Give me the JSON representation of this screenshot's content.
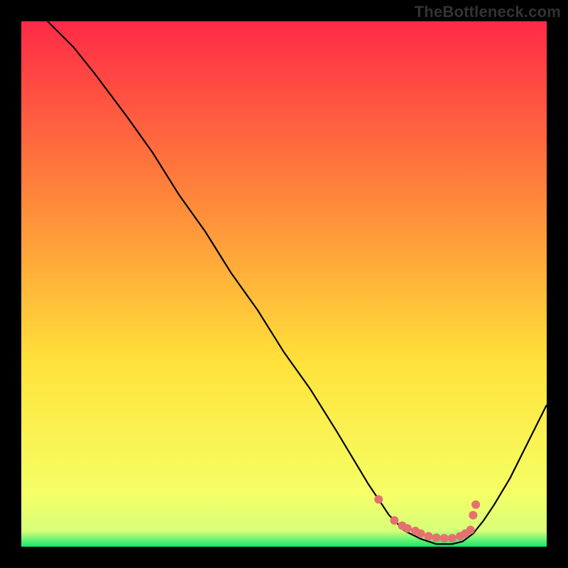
{
  "watermark": "TheBottleneck.com",
  "chart_data": {
    "type": "line",
    "title": "",
    "xlabel": "",
    "ylabel": "",
    "xlim": [
      0,
      100
    ],
    "ylim": [
      0,
      100
    ],
    "grid": false,
    "legend": false,
    "background_gradient": {
      "stops": [
        {
          "offset": 0.0,
          "color": "#ff2a47"
        },
        {
          "offset": 0.35,
          "color": "#ff8a3a"
        },
        {
          "offset": 0.65,
          "color": "#ffe23a"
        },
        {
          "offset": 0.9,
          "color": "#f5ff66"
        },
        {
          "offset": 0.97,
          "color": "#d7ff7a"
        },
        {
          "offset": 1.0,
          "color": "#12e86e"
        }
      ]
    },
    "series": [
      {
        "name": "bottleneck-curve",
        "color": "#000000",
        "x": [
          5,
          10,
          14,
          17,
          20,
          25,
          30,
          35,
          40,
          45,
          50,
          55,
          60,
          63,
          66,
          68,
          70,
          73,
          76,
          79,
          82,
          84,
          86,
          88,
          90,
          93,
          96,
          100
        ],
        "y": [
          100,
          95,
          90,
          86,
          82,
          75,
          67,
          60,
          52,
          45,
          37,
          30,
          22,
          17,
          12,
          9,
          6,
          3,
          1.5,
          0.5,
          0.5,
          1,
          2.5,
          5,
          8,
          13,
          19,
          27
        ]
      }
    ],
    "highlight_points": {
      "name": "sweet-spot",
      "color": "#e4716f",
      "radius": 6,
      "points": [
        {
          "x": 68,
          "y": 9
        },
        {
          "x": 71,
          "y": 5
        },
        {
          "x": 72.5,
          "y": 4
        },
        {
          "x": 73.5,
          "y": 3.5
        },
        {
          "x": 75,
          "y": 3
        },
        {
          "x": 76,
          "y": 2.5
        },
        {
          "x": 77.5,
          "y": 2
        },
        {
          "x": 79,
          "y": 1.7
        },
        {
          "x": 80.5,
          "y": 1.6
        },
        {
          "x": 82,
          "y": 1.6
        },
        {
          "x": 83.5,
          "y": 2
        },
        {
          "x": 84.5,
          "y": 2.5
        },
        {
          "x": 85.5,
          "y": 3.2
        },
        {
          "x": 86,
          "y": 6
        },
        {
          "x": 86.5,
          "y": 8
        }
      ]
    }
  }
}
